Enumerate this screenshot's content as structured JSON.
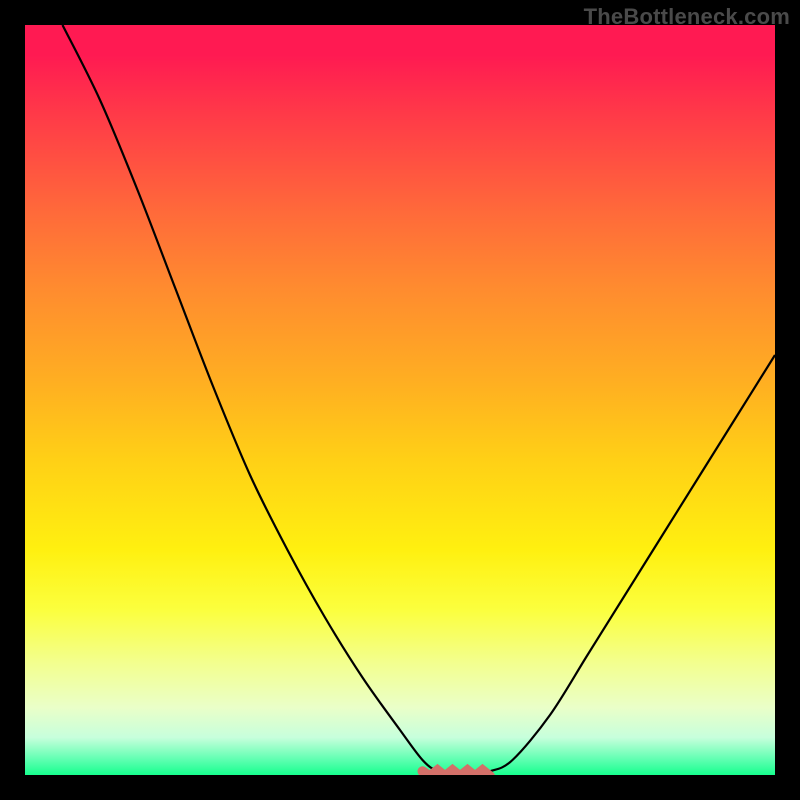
{
  "watermark": "TheBottleneck.com",
  "chart_data": {
    "type": "line",
    "title": "",
    "xlabel": "",
    "ylabel": "",
    "xlim": [
      0,
      100
    ],
    "ylim": [
      0,
      100
    ],
    "series": [
      {
        "name": "bottleneck-curve",
        "x": [
          5,
          10,
          15,
          20,
          25,
          30,
          35,
          40,
          45,
          50,
          53,
          55,
          57,
          60,
          62,
          65,
          70,
          75,
          80,
          85,
          90,
          95,
          100
        ],
        "y": [
          100,
          90,
          78,
          65,
          52,
          40,
          30,
          21,
          13,
          6,
          2,
          0.5,
          0.3,
          0.3,
          0.5,
          2,
          8,
          16,
          24,
          32,
          40,
          48,
          56
        ]
      }
    ],
    "annotations": [
      {
        "name": "valley-marker",
        "x_start": 53,
        "x_end": 62,
        "y": 0.5
      }
    ],
    "grid": false,
    "legend": false
  },
  "colors": {
    "background": "#000000",
    "curve": "#000000",
    "valley_marker": "#d37069",
    "gradient_top": "#ff1a52",
    "gradient_mid": "#ffd016",
    "gradient_bottom": "#17ff8e"
  }
}
